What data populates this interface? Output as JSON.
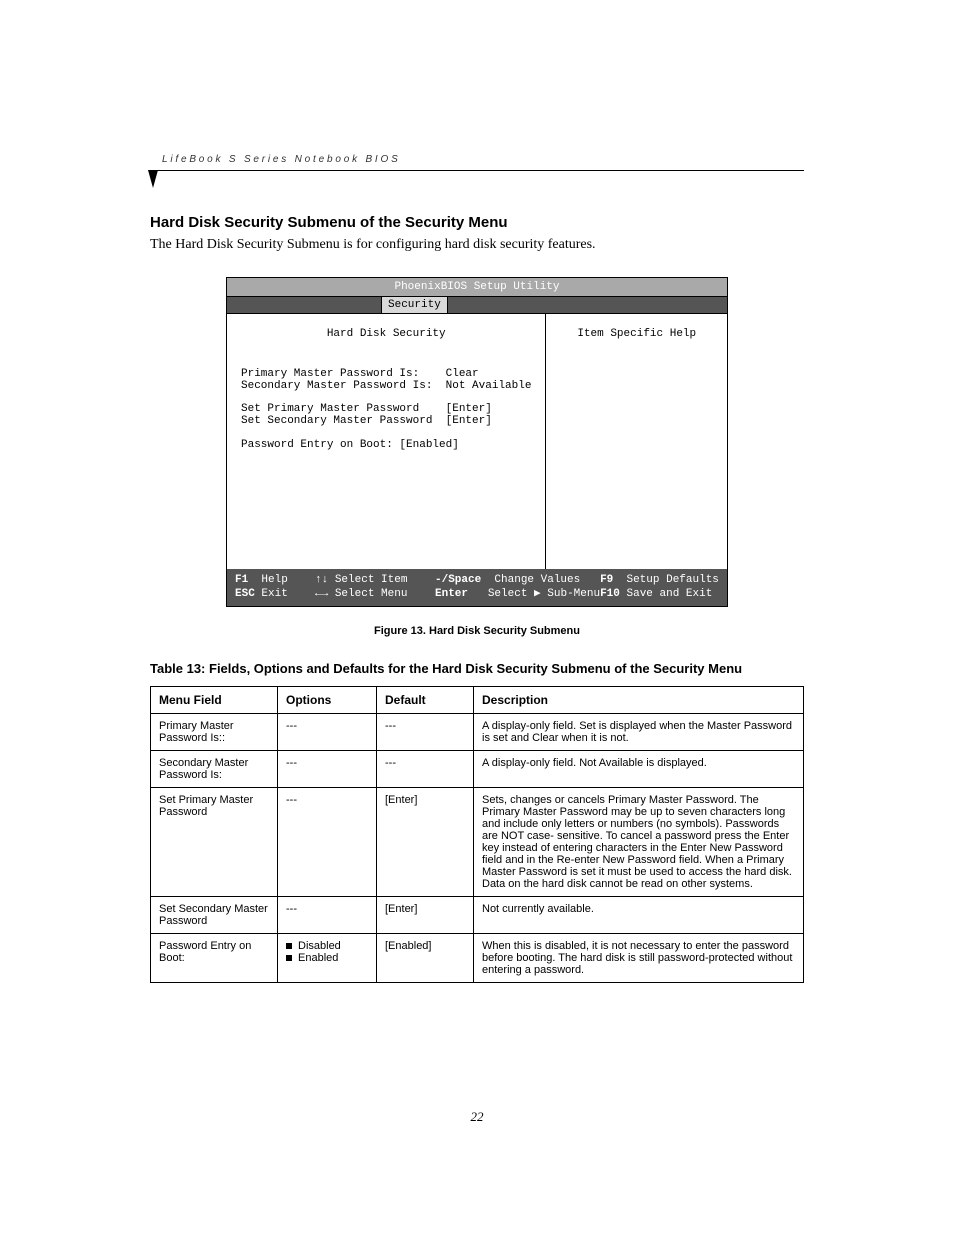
{
  "running_head": "LifeBook S Series Notebook BIOS",
  "section": {
    "title": "Hard Disk Security Submenu of the Security Menu",
    "intro": "The Hard Disk Security Submenu is for configuring hard disk security features."
  },
  "bios": {
    "title": "PhoenixBIOS Setup Utility",
    "tab": "Security",
    "panel_title": "Hard Disk Security",
    "help_title": "Item Specific Help",
    "lines": {
      "l1": "Primary Master Password Is:    Clear",
      "l2": "Secondary Master Password Is:  Not Available",
      "l3": "Set Primary Master Password    [Enter]",
      "l4": "Set Secondary Master Password  [Enter]",
      "l5": "Password Entry on Boot: [Enabled]"
    },
    "footer": {
      "f1": "F1",
      "help": "Help",
      "updown": "↑↓",
      "select_item": "Select Item",
      "minus_space": "-/Space",
      "change_values": "Change Values",
      "f9": "F9",
      "setup_defaults": "Setup Defaults",
      "esc": "ESC",
      "exit": "Exit",
      "leftright": "←→",
      "select_menu": "Select Menu",
      "enter": "Enter",
      "select_sub": "Select ▶ Sub-Menu",
      "f10": "F10",
      "save_exit": "Save and Exit"
    }
  },
  "figure_caption": "Figure 13.   Hard Disk Security Submenu",
  "table_title": "Table 13: Fields, Options and Defaults for the Hard Disk Security Submenu of the Security Menu",
  "table": {
    "headers": {
      "c1": "Menu Field",
      "c2": "Options",
      "c3": "Default",
      "c4": "Description"
    },
    "rows": [
      {
        "field": "Primary Master Password Is::",
        "options": "---",
        "default": "---",
        "desc": "A display-only field. Set is displayed when the Master Password is set and Clear when it is not."
      },
      {
        "field": "Secondary Master Password Is:",
        "options": "---",
        "default": "---",
        "desc": "A display-only field. Not Available is displayed."
      },
      {
        "field": "Set Primary Master Password",
        "options": "---",
        "default": "[Enter]",
        "desc": "Sets, changes or cancels Primary Master Password. The Primary Master Password may be up to seven characters long and include only letters or numbers (no symbols). Passwords are NOT case- sensitive. To cancel a password press the Enter key instead of entering characters in the Enter New Password field and in the Re-enter New Password field. When a Primary Master Password is set it must be used to access the hard disk. Data on the hard disk cannot be read on other systems."
      },
      {
        "field": "Set Secondary Master Password",
        "options": "---",
        "default": "[Enter]",
        "desc": "Not currently available."
      },
      {
        "field": "Password Entry on Boot:",
        "options_list": [
          "Disabled",
          "Enabled"
        ],
        "default": "[Enabled]",
        "desc": "When this is disabled, it is not necessary to enter the password before booting. The hard disk is still password-protected without entering a password."
      }
    ]
  },
  "page_number": "22"
}
